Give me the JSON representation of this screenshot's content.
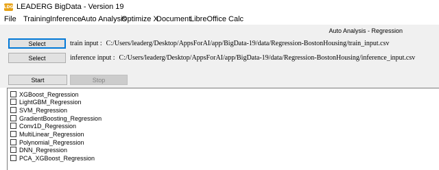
{
  "window": {
    "title": "LEADERG BigData - Version 19",
    "icon_text": "LDG"
  },
  "menu": [
    "File",
    "Training",
    "Inference",
    "Auto Analysis",
    "Optimize X",
    "Document",
    "LibreOffice Calc"
  ],
  "mode_label": "Auto Analysis - Regression",
  "train": {
    "button_label": "Select",
    "label": "train input :",
    "path": "C:/Users/leaderg/Desktop/AppsForAI/app/BigData-19/data/Regression-BostonHousing/train_input.csv"
  },
  "inference": {
    "button_label": "Select",
    "label": "inference input :",
    "path": "C:/Users/leaderg/Desktop/AppsForAI/app/BigData-19/data/Regression-BostonHousing/inference_input.csv"
  },
  "actions": {
    "start_label": "Start",
    "stop_label": "Stop"
  },
  "models": [
    {
      "label": "XGBoost_Regression",
      "checked": false
    },
    {
      "label": "LightGBM_Regression",
      "checked": false
    },
    {
      "label": "SVM_Regression",
      "checked": false
    },
    {
      "label": "GradientBoosting_Regression",
      "checked": false
    },
    {
      "label": "Conv1D_Regression",
      "checked": false
    },
    {
      "label": "MultiLinear_Regression",
      "checked": false
    },
    {
      "label": "Polynomial_Regression",
      "checked": false
    },
    {
      "label": "DNN_Regression",
      "checked": false
    },
    {
      "label": "PCA_XGBoost_Regression",
      "checked": false
    }
  ]
}
